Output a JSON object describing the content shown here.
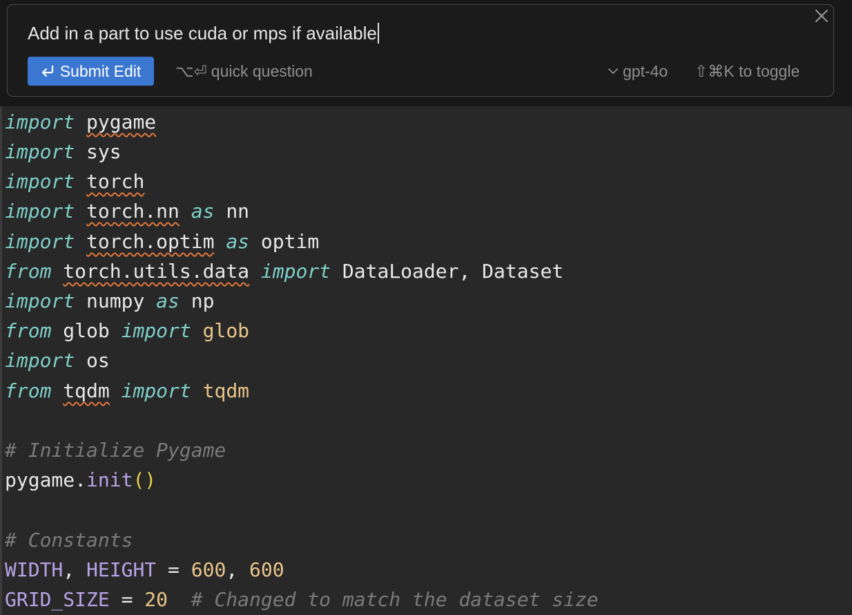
{
  "prompt": {
    "text": "Add in a part to use cuda or mps if available",
    "submit_label": "Submit Edit",
    "quick_question_label": "quick question",
    "quick_question_keys": "⌥⏎",
    "model": "gpt-4o",
    "toggle_hint": "⇧⌘K to toggle"
  },
  "code": {
    "l1": {
      "kw": "import",
      "mod": "pygame"
    },
    "l2": {
      "kw": "import",
      "mod": "sys"
    },
    "l3": {
      "kw": "import",
      "mod": "torch"
    },
    "l4": {
      "kw": "import",
      "mod": "torch.nn",
      "as": "as",
      "alias": "nn"
    },
    "l5": {
      "kw": "import",
      "mod": "torch.optim",
      "as": "as",
      "alias": "optim"
    },
    "l6": {
      "from": "from",
      "mod": "torch.utils.data",
      "kw": "import",
      "names": "DataLoader, Dataset"
    },
    "l7": {
      "kw": "import",
      "mod": "numpy",
      "as": "as",
      "alias": "np"
    },
    "l8": {
      "from": "from",
      "mod": "glob",
      "kw": "import",
      "name": "glob"
    },
    "l9": {
      "kw": "import",
      "mod": "os"
    },
    "l10": {
      "from": "from",
      "mod": "tqdm",
      "kw": "import",
      "name": "tqdm"
    },
    "l12": {
      "comment": "# Initialize Pygame"
    },
    "l13": {
      "obj": "pygame",
      "dot": ".",
      "method": "init",
      "parens": "()"
    },
    "l15": {
      "comment": "# Constants"
    },
    "l16": {
      "c1": "WIDTH",
      "comma": ", ",
      "c2": "HEIGHT",
      "eq": " = ",
      "n1": "600",
      "comma2": ", ",
      "n2": "600"
    },
    "l17": {
      "c1": "GRID_SIZE",
      "eq": " = ",
      "n1": "20",
      "comment": "  # Changed to match the dataset size"
    }
  }
}
